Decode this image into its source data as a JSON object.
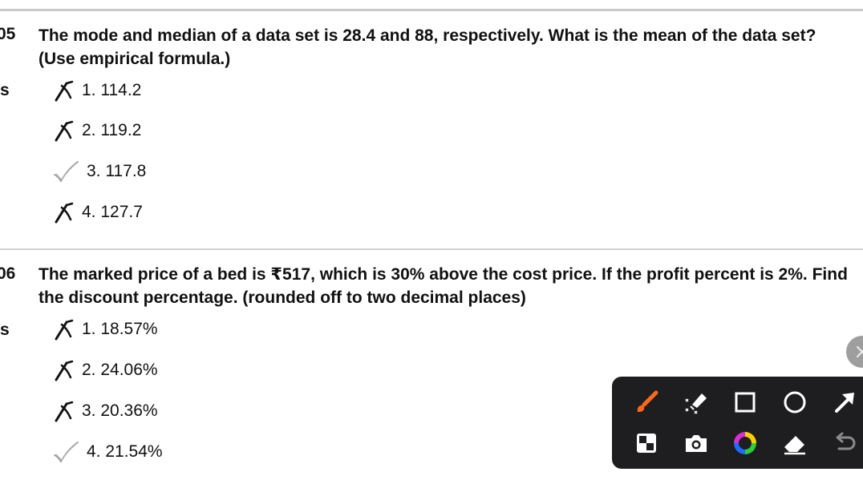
{
  "questions": [
    {
      "number": "05",
      "side_label": "s",
      "text": "The mode and median of a data set is 28.4 and 88, respectively. What is the mean of the data set? (Use empirical formula.)",
      "options": [
        {
          "label": "1. 114.2",
          "status": "wrong"
        },
        {
          "label": "2. 119.2",
          "status": "wrong"
        },
        {
          "label": "3. 117.8",
          "status": "correct"
        },
        {
          "label": "4. 127.7",
          "status": "wrong"
        }
      ]
    },
    {
      "number": "06",
      "side_label": "s",
      "text": "The marked price of a bed is ₹517, which is 30% above the cost price. If the profit percent is 2%. Find the discount percentage. (rounded off to two decimal places)",
      "options": [
        {
          "label": "1. 18.57%",
          "status": "wrong"
        },
        {
          "label": "2. 24.06%",
          "status": "wrong"
        },
        {
          "label": "3. 20.36%",
          "status": "wrong"
        },
        {
          "label": "4. 21.54%",
          "status": "correct"
        }
      ]
    }
  ],
  "annotation_toolbar": {
    "tools": [
      "paintbrush-icon",
      "laser-pointer-icon",
      "rectangle-icon",
      "circle-icon",
      "arrow-icon",
      "mosaic-icon",
      "camera-icon",
      "color-wheel-icon",
      "eraser-icon",
      "undo-icon"
    ],
    "brush_color": "#ff6a1a"
  },
  "colors": {
    "wrong_mark": "#111111",
    "correct_mark": "#9a9a9a",
    "toolbar_bg": "#1e1e20"
  }
}
